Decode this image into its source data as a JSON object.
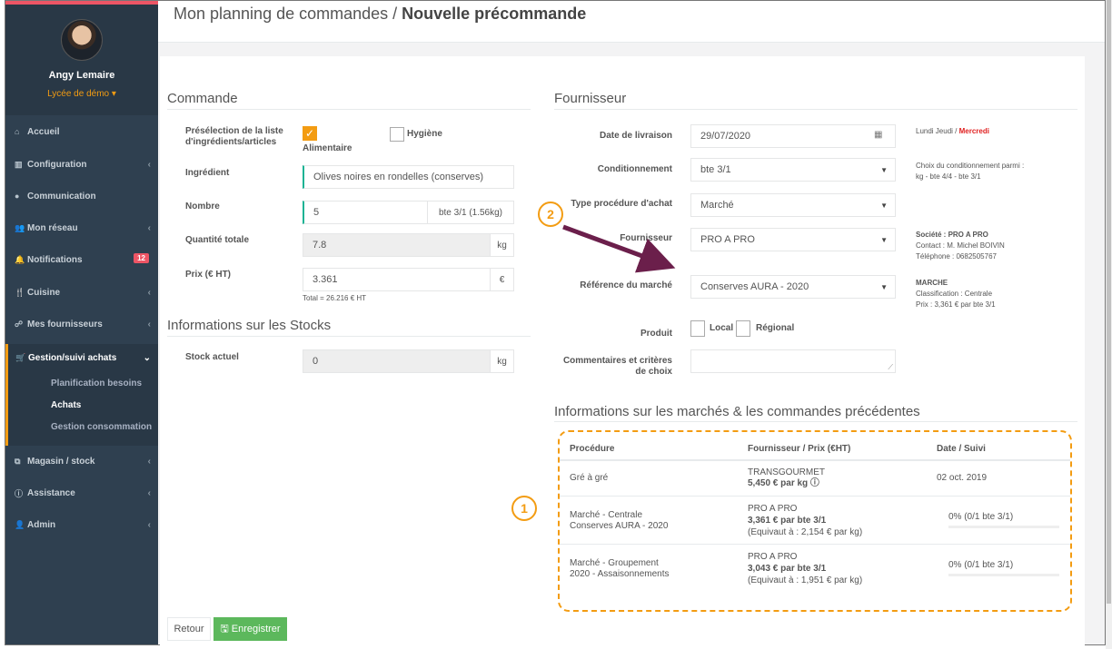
{
  "profile": {
    "name": "Angy Lemaire",
    "school": "Lycée de démo ▾"
  },
  "nav": {
    "accueil": "Accueil",
    "configuration": "Configuration",
    "communication": "Communication",
    "reseau": "Mon réseau",
    "notifications": "Notifications",
    "notifications_badge": "12",
    "cuisine": "Cuisine",
    "fournisseurs": "Mes fournisseurs",
    "gestion": "Gestion/suivi achats",
    "sub_planification": "Planification besoins",
    "sub_achats": "Achats",
    "sub_consommation": "Gestion consommation",
    "magasin": "Magasin / stock",
    "assistance": "Assistance",
    "admin": "Admin"
  },
  "header": {
    "title_prefix": "Mon planning de commandes / ",
    "title_bold": "Nouvelle précommande"
  },
  "commande": {
    "title": "Commande",
    "preselection_label": "Présélection de la liste d'ingrédients/articles",
    "alimentaire_label": "Alimentaire",
    "hygiene_label": "Hygiène",
    "ingredient_label": "Ingrédient",
    "ingredient_value": "Olives noires en rondelles (conserves)",
    "nombre_label": "Nombre",
    "nombre_value": "5",
    "nombre_unit": "bte 3/1 (1.56kg)",
    "quantite_label": "Quantité totale",
    "quantite_value": "7.8",
    "quantite_unit": "kg",
    "prix_label": "Prix (€ HT)",
    "prix_value": "3.361",
    "prix_unit": "€",
    "total_text": "Total = 26.216 € HT"
  },
  "stocks": {
    "title": "Informations sur les Stocks",
    "stock_label": "Stock actuel",
    "stock_value": "0",
    "stock_unit": "kg"
  },
  "fournisseur": {
    "title": "Fournisseur",
    "date_label": "Date de livraison",
    "date_value": "29/07/2020",
    "days_text": "Lundi Jeudi / ",
    "days_highlight": "Mercredi",
    "cond_label": "Conditionnement",
    "cond_value": "bte 3/1",
    "cond_note1": "Choix du conditionnement parmi :",
    "cond_note2": "kg  - bte 4/4  - bte 3/1",
    "type_label": "Type procédure d'achat",
    "type_value": "Marché",
    "fourn_label": "Fournisseur",
    "fourn_value": "PRO A PRO",
    "societe_title": "Société : PRO A PRO",
    "societe_contact": "Contact : M. Michel BOIVIN",
    "societe_tel": "Téléphone : 0682505767",
    "ref_label": "Référence du marché",
    "ref_value": "Conserves AURA - 2020",
    "marche_title": "MARCHE",
    "marche_class": "Classification : Centrale",
    "marche_prix": "Prix : 3,361 € par bte 3/1",
    "produit_label": "Produit",
    "local_label": "Local",
    "regional_label": "Régional",
    "comment_label": "Commentaires et critères de choix"
  },
  "marches": {
    "title": "Informations sur les marchés & les commandes précédentes",
    "headers": [
      "Procédure",
      "Fournisseur / Prix (€HT)",
      "Date / Suivi"
    ],
    "rows": [
      {
        "proc1": "Gré à gré",
        "proc2": "",
        "f1": "TRANSGOURMET",
        "f2": "5,450 € par kg  ⓘ",
        "f3": "",
        "date": "02 oct. 2019"
      },
      {
        "proc1": "Marché - Centrale",
        "proc2": "Conserves AURA - 2020",
        "f1": "PRO A PRO",
        "f2": "3,361 € par bte 3/1",
        "f3": "(Equivaut à : 2,154 € par kg)",
        "date": "0% (0/1 bte 3/1)"
      },
      {
        "proc1": "Marché - Groupement",
        "proc2": "2020 - Assaisonnements",
        "f1": "PRO A PRO",
        "f2": "3,043 € par bte 3/1",
        "f3": "(Equivaut à : 1,951 € par kg)",
        "date": "0% (0/1 bte 3/1)"
      }
    ]
  },
  "buttons": {
    "retour": "Retour",
    "enregistrer": "Enregistrer"
  },
  "callouts": {
    "one": "1",
    "two": "2"
  },
  "colors": {
    "sidebar": "#2f4050",
    "accent": "#f39c12",
    "primary": "#1ab394",
    "save": "#5cb85c",
    "arrow": "#6b1f4b"
  }
}
